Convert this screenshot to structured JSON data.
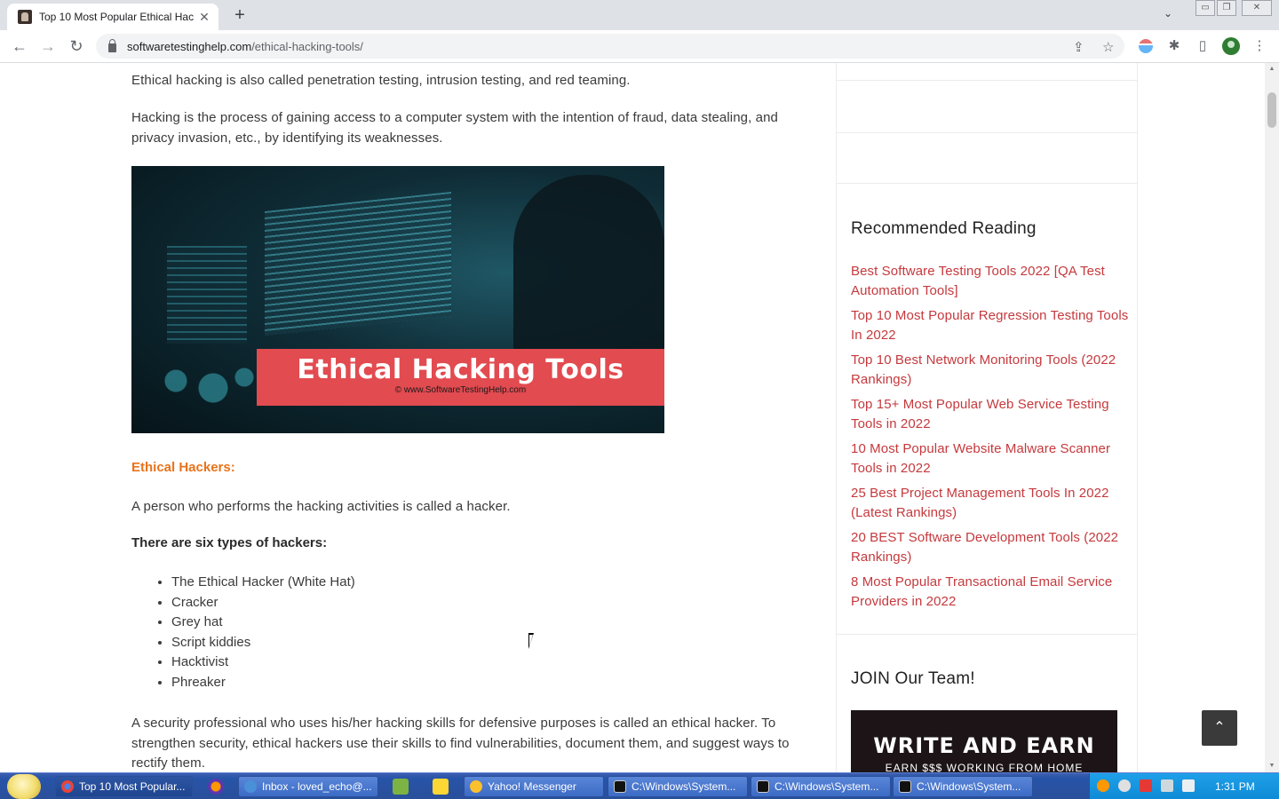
{
  "browser": {
    "tab_title": "Top 10 Most Popular Ethical Hac",
    "tab_close": "✕",
    "new_tab": "+",
    "url_host": "softwaretestinghelp.com",
    "url_path": "/ethical-hacking-tools/",
    "nav_back": "←",
    "nav_forward": "→",
    "nav_reload": "↻",
    "tab_search": "⌄",
    "win_min": "▭",
    "win_max": "❐",
    "win_close": "✕"
  },
  "article": {
    "para1": "Ethical hacking is also called penetration testing, intrusion testing, and red teaming.",
    "para2": "Hacking is the process of gaining access to a computer system with the intention of fraud, data stealing, and privacy invasion, etc., by identifying its weaknesses.",
    "image_title": "Ethical Hacking Tools",
    "image_credit": "© www.SoftwareTestingHelp.com",
    "heading": "Ethical Hackers:",
    "para3": "A person who performs the hacking activities is called a hacker.",
    "types_heading": "There are six types of hackers:",
    "types": [
      "The Ethical Hacker (White Hat)",
      "Cracker",
      "Grey hat",
      "Script kiddies",
      "Hacktivist",
      "Phreaker"
    ],
    "para4": "A security professional who uses his/her hacking skills for defensive purposes is called an ethical hacker. To strengthen security, ethical hackers use their skills to find vulnerabilities, document them, and suggest ways to rectify them."
  },
  "sidebar": {
    "recommended_title": "Recommended Reading",
    "recommended": [
      "Best Software Testing Tools 2022 [QA Test Automation Tools]",
      "Top 10 Most Popular Regression Testing Tools In 2022",
      "Top 10 Best Network Monitoring Tools (2022 Rankings)",
      "Top 15+ Most Popular Web Service Testing Tools in 2022",
      "10 Most Popular Website Malware Scanner Tools in 2022",
      "25 Best Project Management Tools In 2022 (Latest Rankings)",
      "20 BEST Software Development Tools (2022 Rankings)",
      "8 Most Popular Transactional Email Service Providers in 2022"
    ],
    "join_title": "JOIN Our Team!",
    "join_banner_title": "WRITE AND EARN",
    "join_banner_sub": "EARN $$$ WORKING FROM HOME"
  },
  "back_to_top": "⌃",
  "taskbar": {
    "tasks": [
      "Top 10 Most Popular...",
      "Inbox - loved_echo@...",
      "Yahoo! Messenger",
      "C:\\Windows\\System...",
      "C:\\Windows\\System...",
      "C:\\Windows\\System..."
    ],
    "clock": "1:31 PM"
  },
  "colors": {
    "link": "#c5393d",
    "heading_orange": "#e8731c",
    "banner_red": "#e24b50"
  }
}
